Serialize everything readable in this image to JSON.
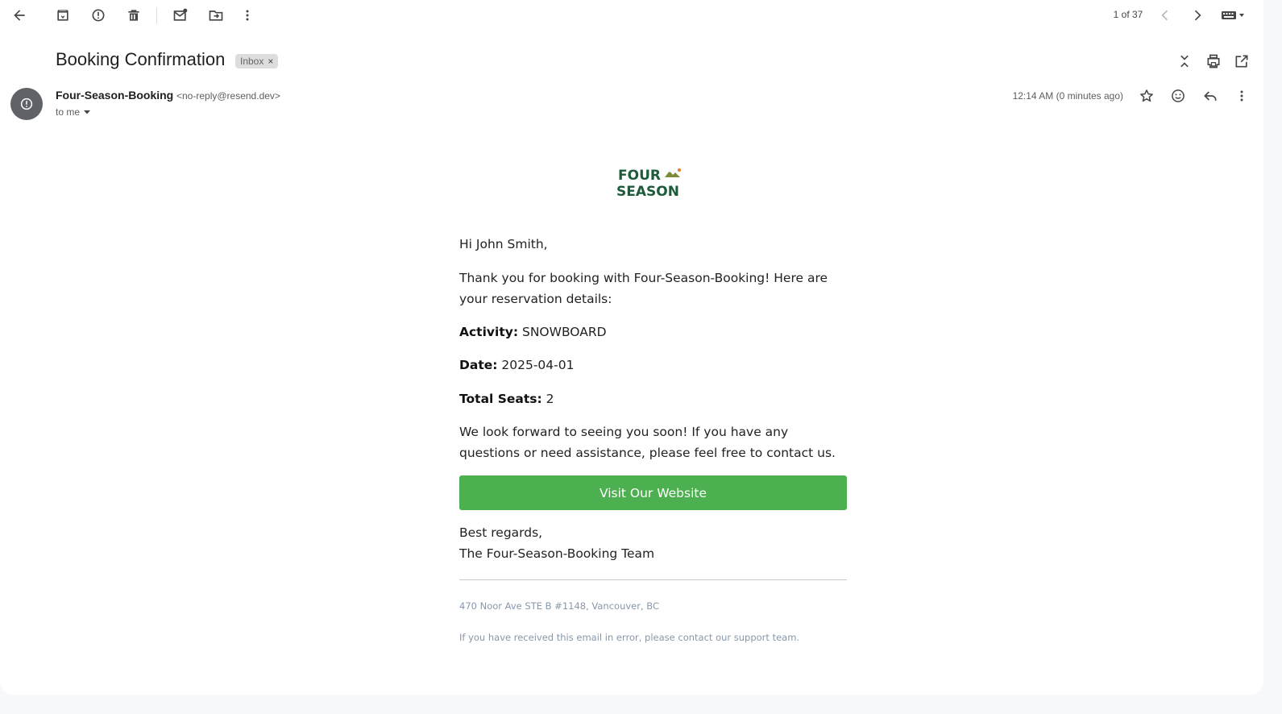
{
  "toolbar": {
    "counter": "1 of 37"
  },
  "email": {
    "subject": "Booking Confirmation",
    "label": "Inbox",
    "label_remove": "×",
    "sender_name": "Four-Season-Booking",
    "sender_email": "<no-reply@resend.dev>",
    "recipient": "to me",
    "timestamp": "12:14 AM (0 minutes ago)"
  },
  "logo": {
    "line1": "FOUR",
    "line2": "SEASON"
  },
  "body": {
    "greeting": "Hi John Smith,",
    "intro": "Thank you for booking with Four-Season-Booking! Here are your reservation details:",
    "activity_label": "Activity:",
    "activity_value": "SNOWBOARD",
    "date_label": "Date:",
    "date_value": "2025-04-01",
    "seats_label": "Total Seats:",
    "seats_value": "2",
    "closing": "We look forward to seeing you soon! If you have any questions or need assistance, please feel free to contact us.",
    "cta_label": "Visit Our Website",
    "regards": "Best regards,",
    "team": "The Four-Season-Booking Team",
    "address": "470 Noor Ave STE B #1148, Vancouver, BC",
    "disclaimer": "If you have received this email in error, please contact our support team."
  },
  "colors": {
    "cta": "#4caf50",
    "logo_green": "#1e5b3a",
    "avatar": "#5f6368"
  },
  "icons": [
    "back-arrow-icon",
    "archive-icon",
    "report-spam-icon",
    "delete-icon",
    "mark-unread-icon",
    "move-to-icon",
    "more-vert-icon",
    "chevron-left-icon",
    "chevron-right-icon",
    "keyboard-icon",
    "collapse-icon",
    "print-icon",
    "open-new-window-icon",
    "star-icon",
    "emoji-icon",
    "reply-icon",
    "sender-more-icon",
    "alert-icon"
  ]
}
